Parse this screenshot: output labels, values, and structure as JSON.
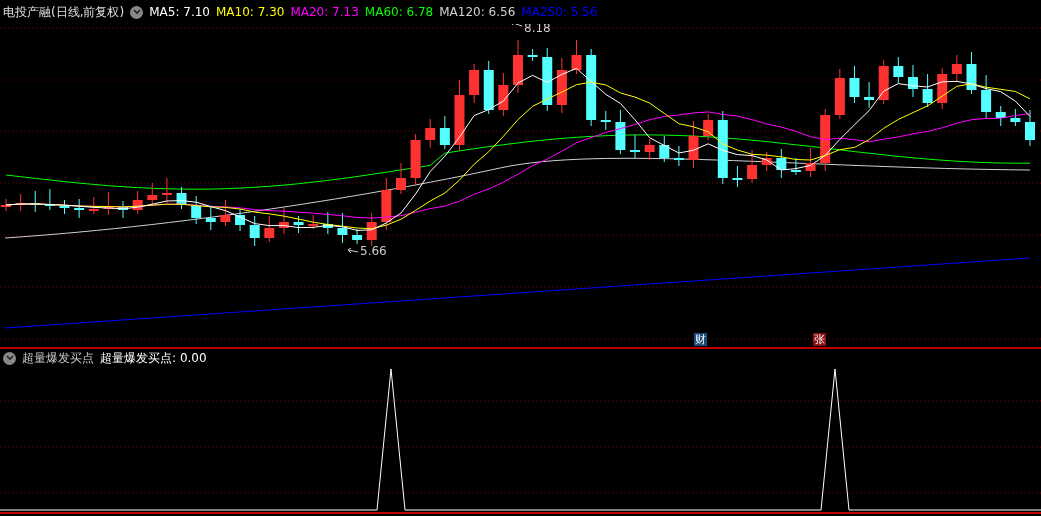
{
  "chart": {
    "title": "电投产融(日线,前复权)",
    "moving_averages": [
      {
        "label": "MA5:",
        "value": "7.10",
        "color": "#ffffff"
      },
      {
        "label": "MA10:",
        "value": "7.30",
        "color": "#ffff00"
      },
      {
        "label": "MA20:",
        "value": "7.13",
        "color": "#ff00ff"
      },
      {
        "label": "MA60:",
        "value": "6.78",
        "color": "#00ff00"
      },
      {
        "label": "MA120:",
        "value": "6.56",
        "color": "#d0d0d0"
      },
      {
        "label": "MA250:",
        "value": "5.56",
        "color": "#0000ff"
      }
    ],
    "high_label": "8.18",
    "low_label": "5.66",
    "markers": [
      {
        "text": "财",
        "kind": "finance"
      },
      {
        "text": "张",
        "kind": "limit"
      }
    ]
  },
  "indicator": {
    "name": "超量爆发买点",
    "value_label": "超量爆发买点:",
    "value": "0.00"
  }
}
